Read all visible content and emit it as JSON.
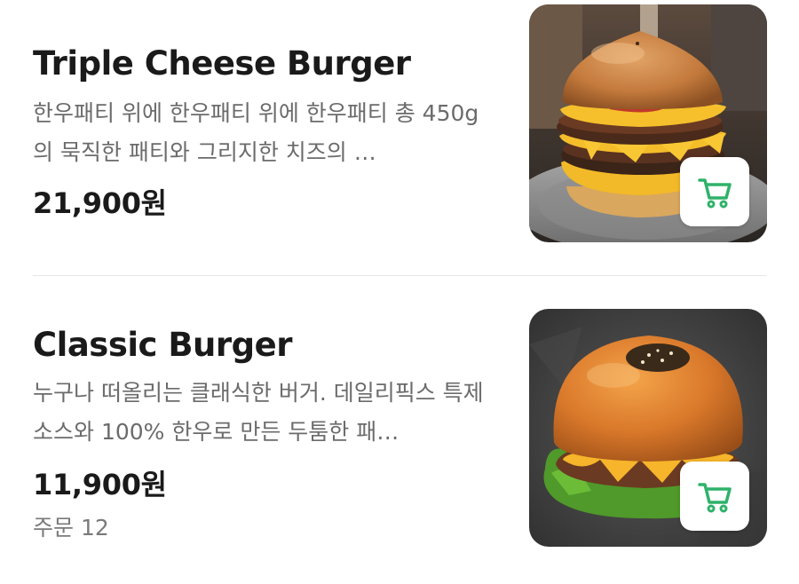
{
  "items": [
    {
      "name": "Triple Cheese Burger",
      "description": "한우패티 위에 한우패티 위에 한우패티 총 450g의 묵직한 패티와 그리지한 치즈의 …",
      "price": "21,900원",
      "image_icon": "burger-photo-icon",
      "cart_icon": "cart-icon"
    },
    {
      "name": "Classic Burger",
      "description": "누구나 떠올리는 클래식한 버거. 데일리픽스 특제 소스와 100% 한우로 만든 두툼한 패…",
      "price": "11,900원",
      "orders": "주문 12",
      "image_icon": "burger-photo-icon",
      "cart_icon": "cart-icon"
    }
  ],
  "colors": {
    "cart_accent": "#2fb26a",
    "title_text": "#1a1a1a",
    "description_text": "#6b6b6b",
    "divider": "#e6e6e6"
  }
}
